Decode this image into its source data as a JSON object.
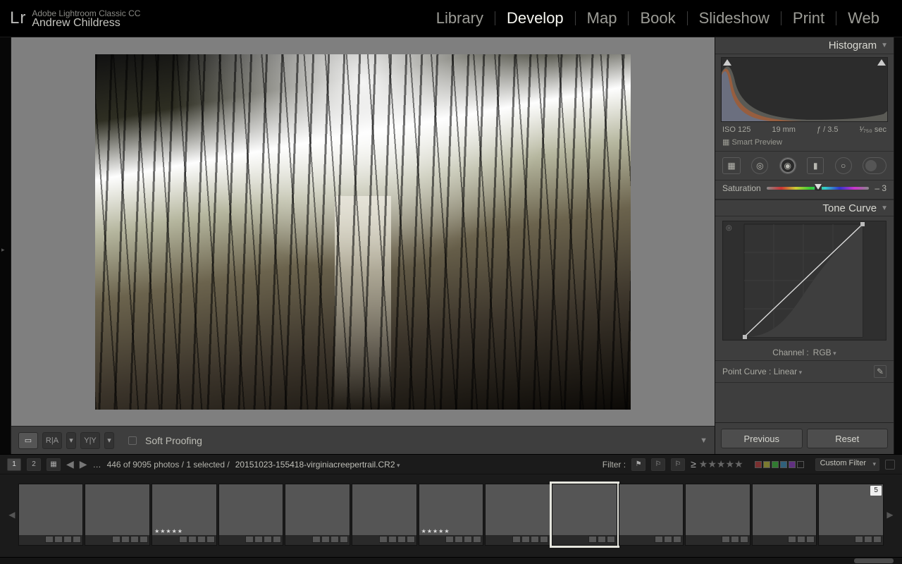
{
  "app": {
    "subtitle": "Adobe Lightroom Classic CC",
    "user": "Andrew Childress",
    "logo": "Lr"
  },
  "modules": {
    "items": [
      "Library",
      "Develop",
      "Map",
      "Book",
      "Slideshow",
      "Print",
      "Web"
    ],
    "active": "Develop"
  },
  "toolbar": {
    "soft_proofing": "Soft Proofing"
  },
  "right": {
    "histogram": {
      "title": "Histogram",
      "meta": {
        "iso": "ISO 125",
        "focal": "19 mm",
        "aperture": "ƒ / 3.5",
        "shutter": "¹⁄₇₅₀ sec"
      },
      "smart_preview": "Smart Preview"
    },
    "tools": [
      "crop",
      "spot",
      "redeye",
      "mask",
      "graduated",
      "radial",
      "brush"
    ],
    "saturation": {
      "label": "Saturation",
      "value": "– 3"
    },
    "tone_curve": {
      "title": "Tone Curve",
      "channel_label": "Channel :",
      "channel_value": "RGB",
      "point_curve_label": "Point Curve :",
      "point_curve_value": "Linear"
    },
    "footer": {
      "previous": "Previous",
      "reset": "Reset"
    }
  },
  "filmstrip": {
    "count_text": "446 of 9095 photos / 1 selected /",
    "filename": "20151023-155418-virginiacreepertrail.CR2",
    "filter_label": "Filter :",
    "filter_dropdown": "Custom Filter",
    "monitors": [
      "1",
      "2"
    ]
  }
}
